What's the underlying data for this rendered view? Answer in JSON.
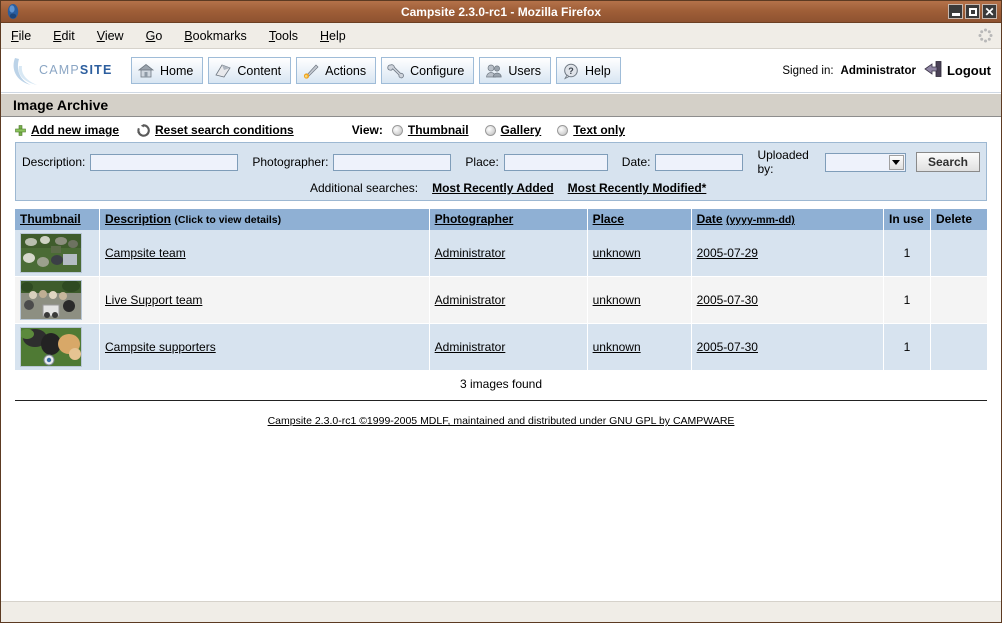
{
  "window": {
    "title": "Campsite 2.3.0-rc1 - Mozilla Firefox",
    "app_icon": "firefox-icon",
    "controls": {
      "minimize": "minimize-button",
      "maximize": "maximize-button",
      "close": "close-button"
    }
  },
  "menubar": {
    "items": [
      {
        "label": "File",
        "accel": "F"
      },
      {
        "label": "Edit",
        "accel": "E"
      },
      {
        "label": "View",
        "accel": "V"
      },
      {
        "label": "Go",
        "accel": "G"
      },
      {
        "label": "Bookmarks",
        "accel": "B"
      },
      {
        "label": "Tools",
        "accel": "T"
      },
      {
        "label": "Help",
        "accel": "H"
      }
    ],
    "throbber": "throbber-icon"
  },
  "app_header": {
    "logo_text_light": "CAMP",
    "logo_text_bold": "SITE",
    "nav": [
      {
        "label": "Home",
        "icon": "home-icon"
      },
      {
        "label": "Content",
        "icon": "content-book-icon"
      },
      {
        "label": "Actions",
        "icon": "actions-rocket-icon"
      },
      {
        "label": "Configure",
        "icon": "wrench-icon"
      },
      {
        "label": "Users",
        "icon": "users-icon"
      },
      {
        "label": "Help",
        "icon": "help-question-icon"
      }
    ],
    "signed_in_label": "Signed in:",
    "signed_in_user": "Administrator",
    "logout_label": "Logout",
    "logout_icon": "logout-arrow-icon"
  },
  "page": {
    "title": "Image Archive"
  },
  "actions": {
    "add_new_image": "Add new image",
    "add_icon": "plus-icon",
    "reset_search": "Reset search conditions",
    "reset_icon": "refresh-icon",
    "view_label": "View:",
    "view_options": [
      {
        "label": "Thumbnail",
        "selected": true
      },
      {
        "label": "Gallery",
        "selected": false
      },
      {
        "label": "Text only",
        "selected": false
      }
    ]
  },
  "search": {
    "description_label": "Description:",
    "description_value": "",
    "photographer_label": "Photographer:",
    "photographer_value": "",
    "place_label": "Place:",
    "place_value": "",
    "date_label": "Date:",
    "date_value": "",
    "uploaded_by_label": "Uploaded by:",
    "uploaded_by_value": "",
    "search_button": "Search",
    "additional_label": "Additional searches:",
    "additional_links": [
      "Most Recently Added",
      "Most Recently Modified*"
    ]
  },
  "table": {
    "headers": {
      "thumbnail": "Thumbnail",
      "description": "Description",
      "description_hint": "(Click to view details)",
      "photographer": "Photographer",
      "place": "Place",
      "date": "Date",
      "date_hint": "(yyyy-mm-dd)",
      "in_use": "In use",
      "delete": "Delete"
    },
    "rows": [
      {
        "thumbnail": "campsite-team-thumbnail",
        "description": "Campsite team",
        "photographer": "Administrator",
        "place": "unknown",
        "date": "2005-07-29",
        "in_use": "1",
        "delete": ""
      },
      {
        "thumbnail": "live-support-team-thumbnail",
        "description": "Live Support team",
        "photographer": "Administrator",
        "place": "unknown",
        "date": "2005-07-30",
        "in_use": "1",
        "delete": ""
      },
      {
        "thumbnail": "campsite-supporters-thumbnail",
        "description": "Campsite supporters",
        "photographer": "Administrator",
        "place": "unknown",
        "date": "2005-07-30",
        "in_use": "1",
        "delete": ""
      }
    ],
    "result_count": "3 images found"
  },
  "footer": {
    "text": "Campsite 2.3.0-rc1 ©1999-2005 MDLF, maintained and distributed under GNU GPL by CAMPWARE"
  },
  "colors": {
    "titlebar": "#a05f38",
    "table_header": "#8fb0d4",
    "row_odd": "#d7e3ef",
    "row_even": "#f4f4f4",
    "search_panel": "#d7e3ef",
    "page_band": "#d4d0c8",
    "accent_blue": "#2c5e9e"
  }
}
